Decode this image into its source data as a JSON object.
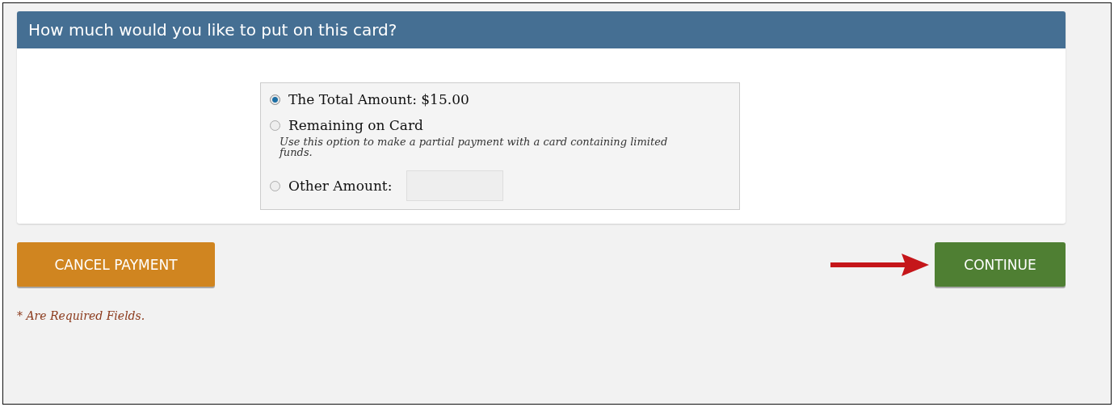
{
  "panel": {
    "title": "How much would you like to put on this card?",
    "options": [
      {
        "label": "The Total Amount: $15.00",
        "selected": true,
        "kind": "plain"
      },
      {
        "label": "Remaining on Card",
        "selected": false,
        "kind": "plain",
        "description": "Use this option to make a partial payment with a card containing limited funds."
      },
      {
        "label": "Other Amount:",
        "selected": false,
        "kind": "input"
      }
    ]
  },
  "buttons": [
    {
      "label": "CANCEL PAYMENT",
      "kind": "cancel"
    },
    {
      "label": "CONTINUE",
      "kind": "continue"
    }
  ],
  "note": "* Are Required Fields."
}
